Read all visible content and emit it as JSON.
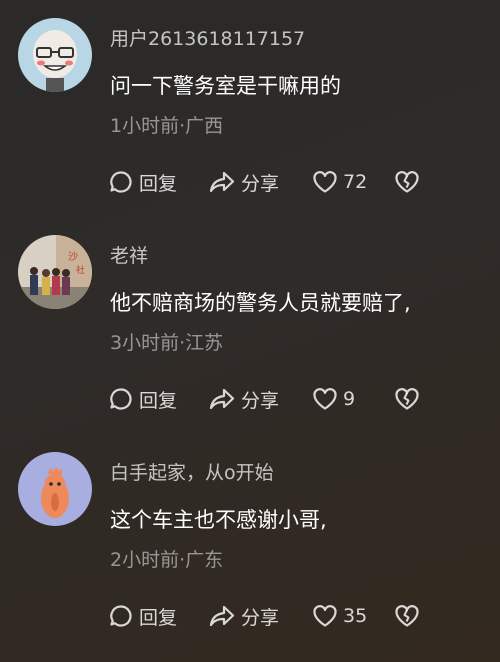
{
  "colors": {
    "background": "#2d2a28",
    "username": "#bdbcbb",
    "meta": "#8f8d8c",
    "text": "#ffffff"
  },
  "actions": {
    "reply_label": "回复",
    "share_label": "分享"
  },
  "comments": [
    {
      "username": "用户2613618117157",
      "text": "问一下警务室是干嘛用的",
      "meta": "1小时前·广西",
      "likes": "72"
    },
    {
      "username": "老祥",
      "text": "他不赔商场的警务人员就要赔了,",
      "meta": "3小时前·江苏",
      "likes": "9"
    },
    {
      "username": "白手起家，从o开始",
      "text": "这个车主也不感谢小哥,",
      "meta": "2小时前·广东",
      "likes": "35"
    }
  ]
}
